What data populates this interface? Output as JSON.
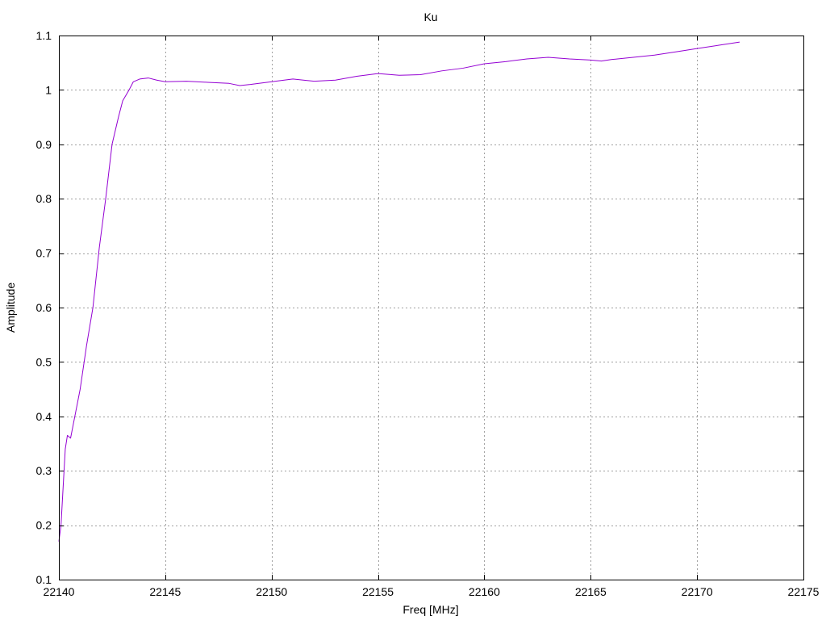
{
  "chart_data": {
    "type": "line",
    "title": "Ku",
    "xlabel": "Freq [MHz]",
    "ylabel": "Amplitude",
    "xlim": [
      22140,
      22175
    ],
    "ylim": [
      0.1,
      1.1
    ],
    "x_ticks": [
      22140,
      22145,
      22150,
      22155,
      22160,
      22165,
      22170,
      22175
    ],
    "x_tick_labels": [
      "22140",
      "22145",
      "22150",
      "22155",
      "22160",
      "22165",
      "22170",
      "22175"
    ],
    "y_ticks": [
      0.1,
      0.2,
      0.3,
      0.4,
      0.5,
      0.6,
      0.7,
      0.8,
      0.9,
      1.0,
      1.1
    ],
    "y_tick_labels": [
      "0.1",
      "0.2",
      "0.3",
      "0.4",
      "0.5",
      "0.6",
      "0.7",
      "0.8",
      "0.9",
      "1",
      "1.1"
    ],
    "grid": true,
    "legend": "none",
    "colors": {
      "line": "#9400d3",
      "grid": "#a0a0a0",
      "axis": "#000000"
    },
    "series": [
      {
        "color": "#9400d3",
        "x": [
          22140.0,
          22140.1,
          22140.2,
          22140.3,
          22140.4,
          22140.55,
          22140.8,
          22141.0,
          22141.3,
          22141.6,
          22141.9,
          22142.2,
          22142.5,
          22142.8,
          22143.0,
          22143.3,
          22143.5,
          22143.8,
          22144.2,
          22144.6,
          22145.0,
          22146.0,
          22147.0,
          22148.0,
          22148.5,
          22149.0,
          22150.0,
          22151.0,
          22152.0,
          22153.0,
          22154.0,
          22155.0,
          22156.0,
          22157.0,
          22158.0,
          22159.0,
          22160.0,
          22161.0,
          22162.0,
          22163.0,
          22164.0,
          22165.0,
          22165.5,
          22166.0,
          22167.0,
          22168.0,
          22169.0,
          22170.0,
          22171.0,
          22172.0
        ],
        "y": [
          0.17,
          0.2,
          0.27,
          0.34,
          0.365,
          0.36,
          0.41,
          0.45,
          0.53,
          0.6,
          0.71,
          0.8,
          0.9,
          0.95,
          0.98,
          1.0,
          1.015,
          1.02,
          1.022,
          1.018,
          1.015,
          1.016,
          1.014,
          1.012,
          1.008,
          1.01,
          1.015,
          1.02,
          1.016,
          1.018,
          1.025,
          1.03,
          1.027,
          1.028,
          1.035,
          1.04,
          1.048,
          1.052,
          1.057,
          1.06,
          1.057,
          1.055,
          1.053,
          1.056,
          1.06,
          1.064,
          1.07,
          1.076,
          1.082,
          1.088
        ]
      }
    ]
  }
}
